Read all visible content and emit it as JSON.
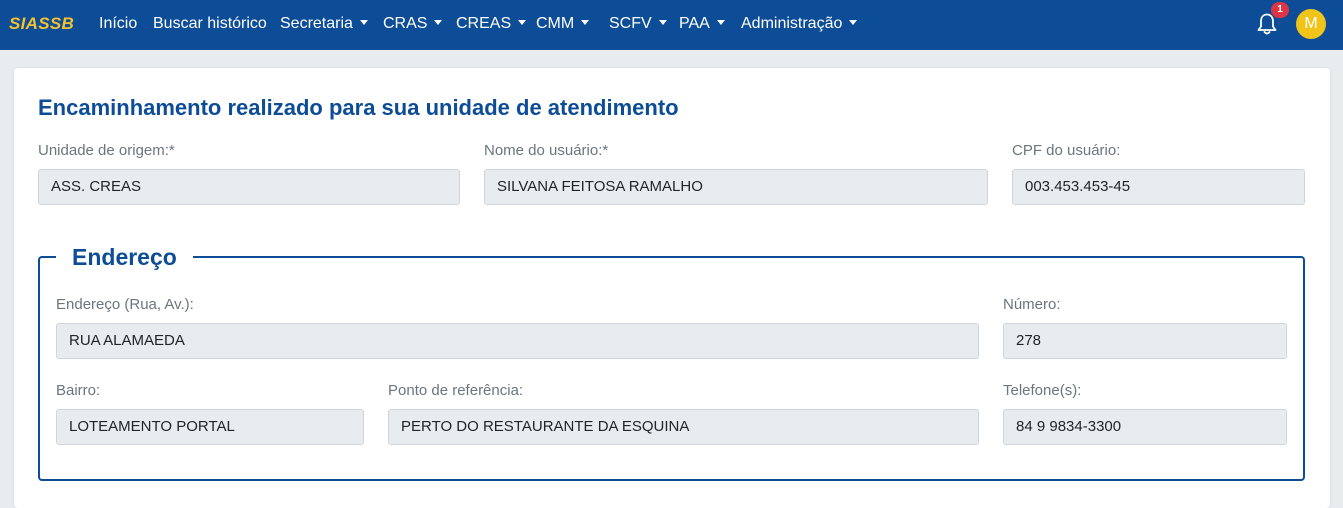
{
  "navbar": {
    "brand": "SIASSB",
    "items": [
      {
        "label": "Início",
        "dropdown": false
      },
      {
        "label": "Buscar histórico",
        "dropdown": false
      },
      {
        "label": "Secretaria",
        "dropdown": true
      },
      {
        "label": "CRAS",
        "dropdown": true
      },
      {
        "label": "CREAS",
        "dropdown": true
      },
      {
        "label": "CMM",
        "dropdown": true
      },
      {
        "label": "SCFV",
        "dropdown": true
      },
      {
        "label": "PAA",
        "dropdown": true
      },
      {
        "label": "Administração",
        "dropdown": true
      }
    ],
    "notifications_count": "1",
    "avatar_initial": "M",
    "icons": {
      "notifications": "bell-icon",
      "dropdown": "caret-down-icon"
    },
    "colors": {
      "navbar_bg": "#0d4c96",
      "brand": "#f2c230",
      "badge": "#dc3545",
      "avatar": "#f0c419"
    }
  },
  "form": {
    "title": "Encaminhamento realizado para sua unidade de atendimento",
    "unidade_origem": {
      "label": "Unidade de origem:*",
      "value": "ASS. CREAS"
    },
    "nome_usuario": {
      "label": "Nome do usuário:*",
      "value": "SILVANA FEITOSA RAMALHO"
    },
    "cpf_usuario": {
      "label": "CPF do usuário:",
      "value": "003.453.453-45"
    },
    "endereco_section": {
      "legend": "Endereço",
      "endereco": {
        "label": "Endereço (Rua, Av.):",
        "value": "RUA ALAMAEDA"
      },
      "numero": {
        "label": "Número:",
        "value": "278"
      },
      "bairro": {
        "label": "Bairro:",
        "value": "LOTEAMENTO PORTAL"
      },
      "ponto_referencia": {
        "label": "Ponto de referência:",
        "value": "PERTO DO RESTAURANTE DA ESQUINA"
      },
      "telefones": {
        "label": "Telefone(s):",
        "value": "84 9 9834-3300"
      }
    }
  }
}
